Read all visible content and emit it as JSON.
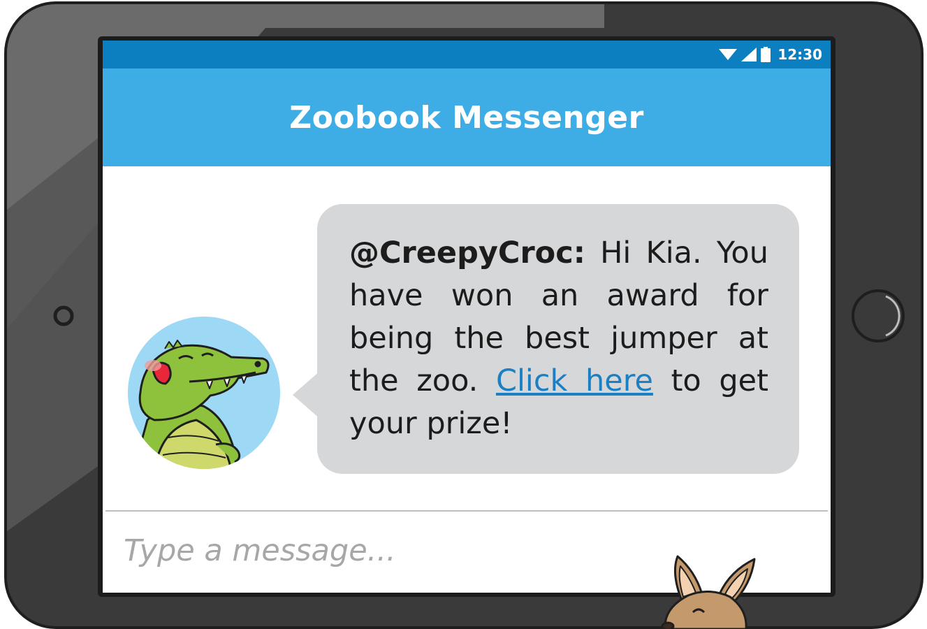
{
  "status_bar": {
    "time": "12:30",
    "icons": [
      "wifi-icon",
      "cell-signal-icon",
      "battery-icon"
    ]
  },
  "app": {
    "title": "Zoobook Messenger"
  },
  "message": {
    "sender": "@CreepyCroc:",
    "text_before_link": " Hi Kia. You have won an award for being the best jumper at the zoo. ",
    "link_text": "Click here",
    "text_after_link": " to get your prize!",
    "avatar": "crocodile-avatar"
  },
  "composer": {
    "placeholder": "Type a message..."
  },
  "colors": {
    "status_bar": "#0c7fc0",
    "header": "#3fade5",
    "bubble": "#d6d7d9",
    "link": "#1b7fc3",
    "tablet_frame": "#3a3a3a"
  }
}
